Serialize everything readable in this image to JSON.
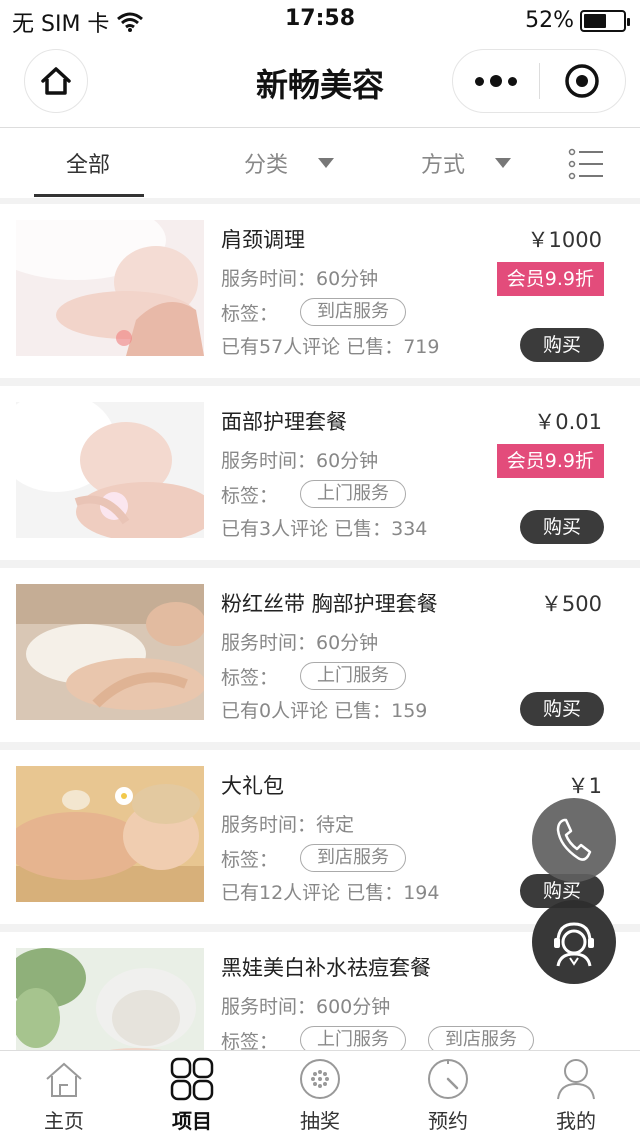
{
  "status_bar": {
    "carrier": "无 SIM 卡",
    "time": "17:58",
    "battery": "52%"
  },
  "nav": {
    "title": "新畅美容"
  },
  "filter": {
    "tabs": [
      {
        "label": "全部"
      },
      {
        "label": "分类"
      },
      {
        "label": "方式"
      }
    ]
  },
  "products": [
    {
      "title": "肩颈调理",
      "price": "￥1000",
      "member": "会员9.9折",
      "service_time": "服务时间：60分钟",
      "tag_label": "标签：",
      "tags": [
        "到店服务"
      ],
      "reviews_sold": "已有57人评论 已售：719",
      "buy": "购买"
    },
    {
      "title": "面部护理套餐",
      "price": "￥0.01",
      "member": "会员9.9折",
      "service_time": "服务时间：60分钟",
      "tag_label": "标签：",
      "tags": [
        "上门服务"
      ],
      "reviews_sold": "已有3人评论 已售：334",
      "buy": "购买"
    },
    {
      "title": "粉红丝带 胸部护理套餐",
      "price": "￥500",
      "member": "",
      "service_time": "服务时间：60分钟",
      "tag_label": "标签：",
      "tags": [
        "上门服务"
      ],
      "reviews_sold": "已有0人评论 已售：159",
      "buy": "购买"
    },
    {
      "title": "大礼包",
      "price": "￥1",
      "member": "",
      "service_time": "服务时间：待定",
      "tag_label": "标签：",
      "tags": [
        "到店服务"
      ],
      "reviews_sold": "已有12人评论 已售：194",
      "buy": "购买"
    },
    {
      "title": "黑娃美白补水祛痘套餐",
      "price": "",
      "member": "",
      "service_time": "服务时间：600分钟",
      "tag_label": "标签：",
      "tags": [
        "上门服务",
        "到店服务"
      ],
      "reviews_sold": "",
      "buy": ""
    }
  ],
  "tab_bar": {
    "items": [
      {
        "label": "主页"
      },
      {
        "label": "项目"
      },
      {
        "label": "抽奖"
      },
      {
        "label": "预约"
      },
      {
        "label": "我的"
      }
    ]
  },
  "colors": {
    "member_badge": "#e34c7b",
    "buy_button": "#3b3b3b"
  },
  "icons": [
    "home-icon",
    "more-icon",
    "target-icon",
    "list-view-icon",
    "phone-icon",
    "customer-service-icon",
    "tab-home-icon",
    "tab-project-icon",
    "tab-lottery-icon",
    "tab-appointment-icon",
    "tab-profile-icon"
  ]
}
